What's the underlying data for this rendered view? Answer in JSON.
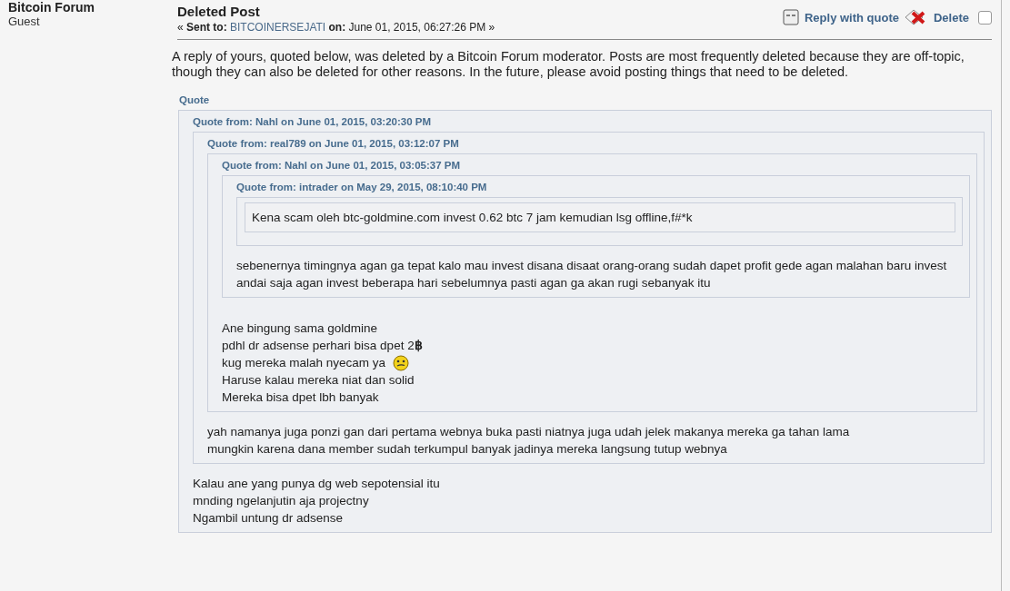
{
  "poster": {
    "name": "Bitcoin Forum",
    "role": "Guest"
  },
  "post": {
    "title": "Deleted Post",
    "sent_prefix": "« ",
    "sent_label": "Sent to:",
    "recipient": "BITCOINERSEJATI",
    "on_label": "on:",
    "date": "June 01, 2015, 06:27:26 PM »",
    "actions": [
      {
        "kind": "quote",
        "label": "Reply with quote"
      },
      {
        "kind": "delete",
        "label": "Delete"
      }
    ],
    "select_checkbox": {
      "checked": false
    },
    "notice": "A reply of yours, quoted below, was deleted by a Bitcoin Forum moderator. Posts are most frequently deleted because they are off-topic, though they can also be deleted for other reasons. In the future, please avoid posting things that need to be deleted.",
    "quote": {
      "header": "Quote",
      "lines": [
        {
          "kind": "text",
          "text": "Kalau ane yang punya dg web sepotensial itu"
        },
        {
          "kind": "text",
          "text": "mnding ngelanjutin aja projectny"
        },
        {
          "kind": "text",
          "text": "Ngambil untung dr adsense"
        }
      ],
      "quote": {
        "header": "Quote from: Nahl on June 01, 2015, 03:20:30 PM",
        "lines": [
          {
            "kind": "text",
            "text": "yah namanya juga ponzi gan dari pertama webnya buka pasti niatnya juga udah jelek makanya mereka ga tahan lama"
          },
          {
            "kind": "text",
            "text": "mungkin karena dana member sudah terkumpul  banyak jadinya mereka langsung tutup webnya"
          }
        ],
        "quote": {
          "header": "Quote from: real789 on June 01, 2015, 03:12:07 PM",
          "lines": [
            {
              "kind": "text",
              "text": "Ane bingung sama goldmine"
            },
            {
              "kind": "text",
              "text": "pdhl dr adsense perhari bisa dpet 2**฿**"
            },
            {
              "kind": "smiley",
              "text": "kug mereka malah nyecam ya"
            },
            {
              "kind": "text",
              "text": "Haruse kalau mereka niat dan solid"
            },
            {
              "kind": "text",
              "text": "Mereka bisa dpet lbh banyak"
            }
          ],
          "quote": {
            "header": "Quote from: Nahl on June 01, 2015, 03:05:37 PM",
            "lines": [
              {
                "kind": "text",
                "text": "sebenernya timingnya agan ga tepat kalo mau invest disana disaat orang-orang sudah dapet profit gede agan malahan baru invest"
              },
              {
                "kind": "text",
                "text": "andai saja agan invest beberapa hari sebelumnya pasti agan ga akan rugi sebanyak itu"
              }
            ],
            "quote": {
              "header": "Quote from: intrader on May 29, 2015, 08:10:40 PM",
              "lines": [
                {
                  "kind": "framed",
                  "text": "Kena scam oleh btc-goldmine.com invest 0.62 btc 7 jam kemudian lsg offline,f#*k"
                }
              ]
            }
          }
        }
      }
    }
  }
}
